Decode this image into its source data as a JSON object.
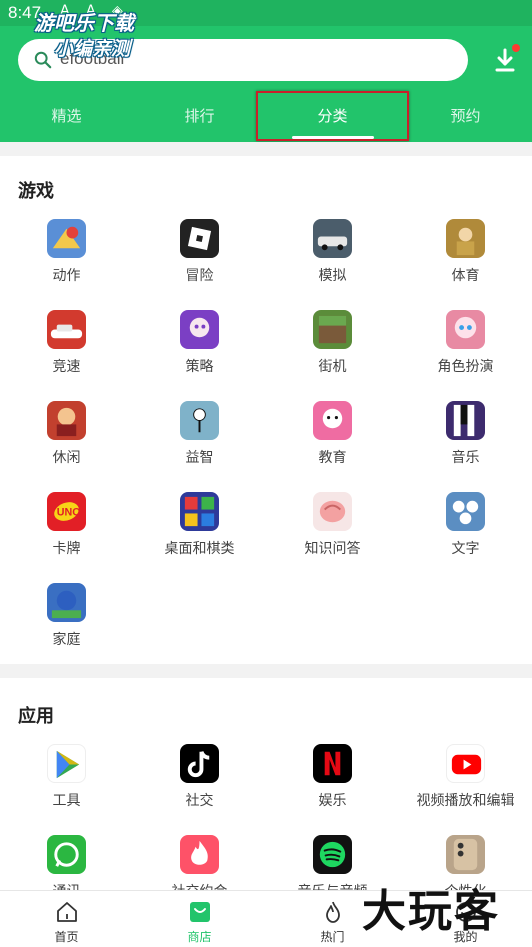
{
  "status_bar": {
    "time": "8:47",
    "icons": "A A ◈"
  },
  "watermark": {
    "line1": "游吧乐下载",
    "line2": "小编亲测"
  },
  "search": {
    "value": "efootball"
  },
  "tabs": [
    {
      "label": "精选",
      "active": false
    },
    {
      "label": "排行",
      "active": false
    },
    {
      "label": "分类",
      "active": true
    },
    {
      "label": "预约",
      "active": false
    }
  ],
  "games": {
    "title": "游戏",
    "items": [
      {
        "label": "动作",
        "icon": "action-game-icon",
        "color": "#5a8fd6"
      },
      {
        "label": "冒险",
        "icon": "roblox-icon",
        "color": "#222222"
      },
      {
        "label": "模拟",
        "icon": "car-sim-icon",
        "color": "#4b5d6b"
      },
      {
        "label": "体育",
        "icon": "soccer-icon",
        "color": "#b08a3a"
      },
      {
        "label": "竞速",
        "icon": "racing-car-icon",
        "color": "#d23a2e"
      },
      {
        "label": "策略",
        "icon": "strategy-icon",
        "color": "#7b3fc4"
      },
      {
        "label": "街机",
        "icon": "minecraft-icon",
        "color": "#5b8c3a"
      },
      {
        "label": "角色扮演",
        "icon": "roleplay-icon",
        "color": "#e88aa3"
      },
      {
        "label": "休闲",
        "icon": "casual-icon",
        "color": "#c2402e"
      },
      {
        "label": "益智",
        "icon": "puzzle-icon",
        "color": "#7fb2c9"
      },
      {
        "label": "教育",
        "icon": "education-icon",
        "color": "#ef6ca2"
      },
      {
        "label": "音乐",
        "icon": "music-tiles-icon",
        "color": "#3d2b6e"
      },
      {
        "label": "卡牌",
        "icon": "uno-icon",
        "color": "#e21f26"
      },
      {
        "label": "桌面和棋类",
        "icon": "ludo-icon",
        "color": "#2e3a9a"
      },
      {
        "label": "知识问答",
        "icon": "brain-quiz-icon",
        "color": "#f6e6e6"
      },
      {
        "label": "文字",
        "icon": "word-game-icon",
        "color": "#5b8ec2"
      },
      {
        "label": "家庭",
        "icon": "family-game-icon",
        "color": "#3a6fc2"
      }
    ]
  },
  "apps": {
    "title": "应用",
    "items": [
      {
        "label": "工具",
        "icon": "play-store-icon",
        "color": "#ffffff"
      },
      {
        "label": "社交",
        "icon": "tiktok-icon",
        "color": "#000000"
      },
      {
        "label": "娱乐",
        "icon": "netflix-icon",
        "color": "#000000"
      },
      {
        "label": "视频播放和编辑",
        "icon": "youtube-icon",
        "color": "#ffffff"
      },
      {
        "label": "通讯",
        "icon": "whatsapp-icon",
        "color": "#2bb741"
      },
      {
        "label": "社交约会",
        "icon": "tinder-icon",
        "color": "#fe5268"
      },
      {
        "label": "音乐与音频",
        "icon": "spotify-icon",
        "color": "#111111"
      },
      {
        "label": "个性化",
        "icon": "personalization-icon",
        "color": "#b9a48a"
      }
    ]
  },
  "bottom_nav": [
    {
      "label": "首页",
      "icon": "home-icon",
      "active": false
    },
    {
      "label": "商店",
      "icon": "store-bag-icon",
      "active": true
    },
    {
      "label": "热门",
      "icon": "flame-icon",
      "active": false
    },
    {
      "label": "我的",
      "icon": "profile-icon",
      "active": false
    }
  ],
  "brand_mark": "大玩客",
  "colors": {
    "accent": "#22c46b",
    "highlight_box": "#c8202a"
  }
}
